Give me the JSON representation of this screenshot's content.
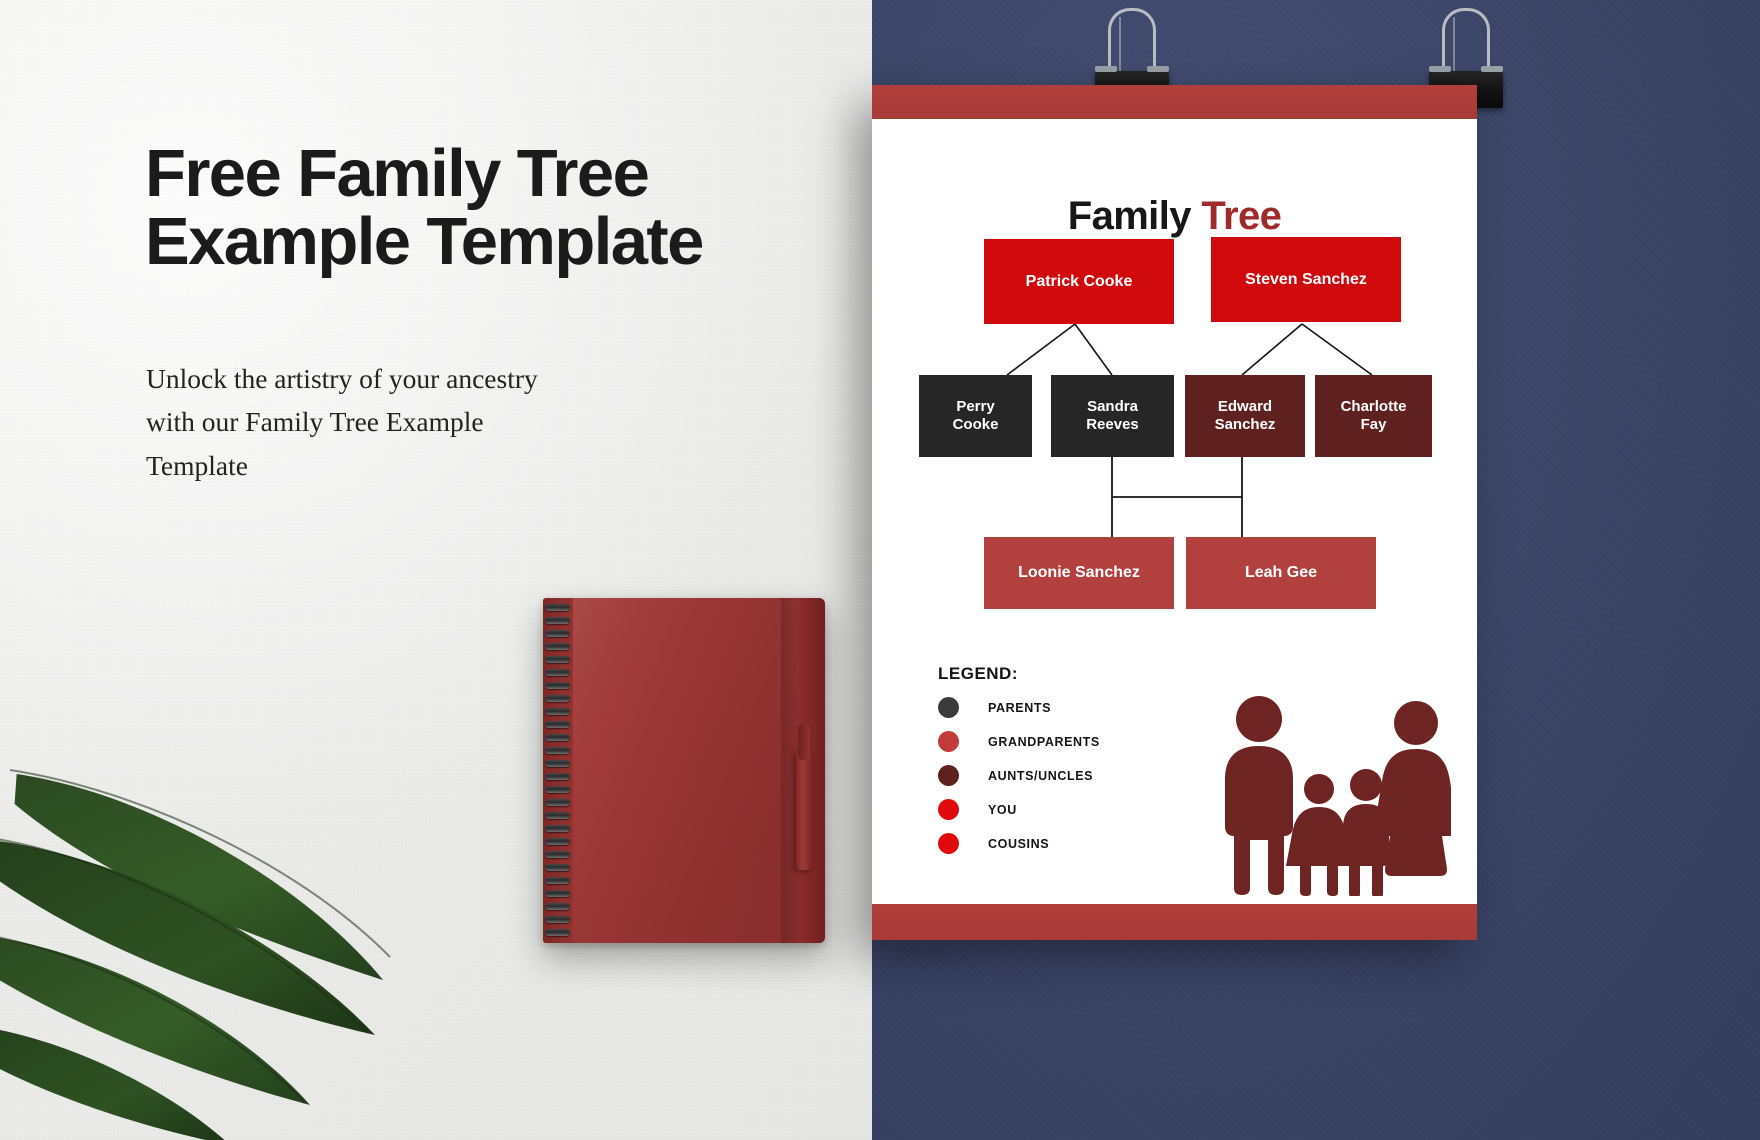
{
  "promo": {
    "headline": "Free Family Tree Example Template",
    "subcopy": "Unlock the artistry of your ancestry with our Family Tree Example Template"
  },
  "poster": {
    "title_main": "Family",
    "title_accent": "Tree",
    "colors": {
      "generation1": "#d00a0c",
      "parents": "#262626",
      "aunts_uncles": "#5e2120",
      "cousins": "#b1403e",
      "grandparents": "#c03b3a",
      "you": "#e00a0c",
      "band": "#ad3b38",
      "wall": "#3b4568"
    },
    "tree": {
      "generation_1": [
        {
          "name": "Patrick Cooke"
        },
        {
          "name": "Steven Sanchez"
        }
      ],
      "generation_2": [
        {
          "name": "Perry Cooke",
          "line1": "Perry",
          "line2": "Cooke",
          "category": "parents"
        },
        {
          "name": "Sandra Reeves",
          "line1": "Sandra",
          "line2": "Reeves",
          "category": "parents"
        },
        {
          "name": "Edward Sanchez",
          "line1": "Edward",
          "line2": "Sanchez",
          "category": "aunts"
        },
        {
          "name": "Charlotte Fay",
          "line1": "Charlotte",
          "line2": "Fay",
          "category": "aunts"
        }
      ],
      "generation_3": [
        {
          "name": "Loonie Sanchez"
        },
        {
          "name": "Leah Gee"
        }
      ]
    },
    "legend": {
      "title": "LEGEND:",
      "items": [
        {
          "label": "PARENTS",
          "color": "#3a3a3a"
        },
        {
          "label": "GRANDPARENTS",
          "color": "#c03b3a"
        },
        {
          "label": "AUNTS/UNCLES",
          "color": "#5e2120"
        },
        {
          "label": "YOU",
          "color": "#e00a0c"
        },
        {
          "label": "COUSINS",
          "color": "#e00a0c"
        }
      ]
    }
  }
}
